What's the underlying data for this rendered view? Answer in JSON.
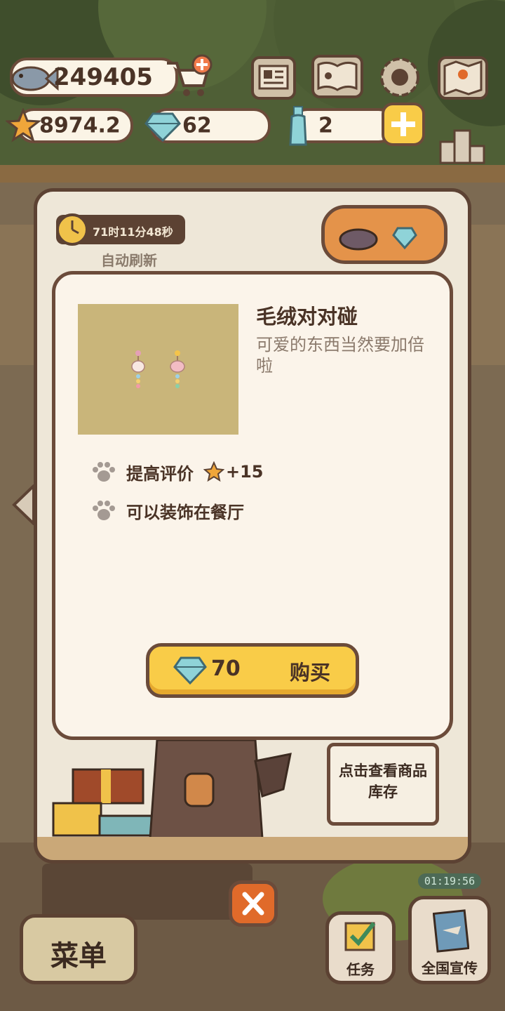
{
  "resources": {
    "fish": "249405",
    "stars": "8974.2",
    "gems": "62",
    "bottles": "2"
  },
  "shop": {
    "timer": "71时11分48秒",
    "auto_refresh": "自动刷新",
    "inventory_note": "点击查看商品库存"
  },
  "item": {
    "title": "毛绒对对碰",
    "description": "可爱的东西当然要加倍啦",
    "features": [
      {
        "text": "提高评价",
        "bonus": "+15"
      },
      {
        "text": "可以装饰在餐厅"
      }
    ],
    "price": "70",
    "buy_label": "购买"
  },
  "bottom": {
    "menu_label": "菜单",
    "task_label": "任务",
    "promo_label": "全国宣传",
    "promo_timer": "01:19:56"
  },
  "colors": {
    "accent_yellow": "#f9cc48",
    "outline_brown": "#6b4b3a",
    "panel_cream": "#fbf4ea",
    "close_orange": "#e06a2a"
  }
}
